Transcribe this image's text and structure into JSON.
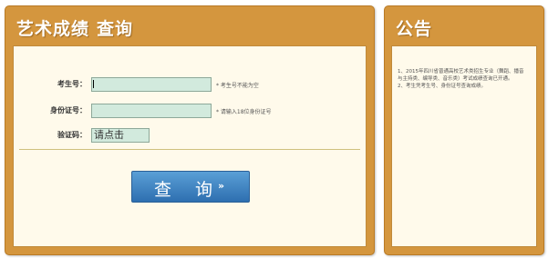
{
  "query_panel": {
    "title_part1": "艺术成绩",
    "title_part2": "查询",
    "exam_no": {
      "label": "考生号：",
      "value": "",
      "hint": "* 考生号不能为空"
    },
    "id_no": {
      "label": "身份证号：",
      "value": "",
      "hint": "* 请输入18位身份证号"
    },
    "captcha": {
      "label": "验证码：",
      "text": "请点击"
    },
    "submit": {
      "label": "查 询",
      "arrow": "››"
    }
  },
  "notice_panel": {
    "title": "公告",
    "items": [
      "1、2015年四川省普通高校艺术类招生专业（舞蹈、播音与主持类、编导类、音乐类）考试成绩查询已开通。",
      "2、考生凭考生号、身份证号查询成绩。"
    ]
  },
  "colors": {
    "panel_frame": "#d4963e",
    "panel_body": "#fffaeb",
    "input_bg": "#d2eadd",
    "button_blue": "#2e6fb0"
  }
}
